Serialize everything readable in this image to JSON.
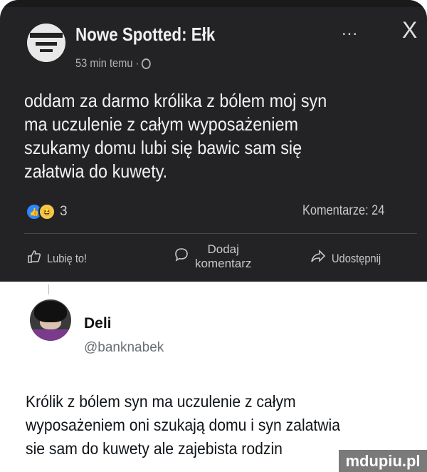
{
  "post": {
    "page_name": "Nowe Spotted: Ełk",
    "time": "53 min temu ·",
    "more": "...",
    "close": "X",
    "text": "oddam za darmo królika z bólem moj syn\nma uczulenie z całym wyposażeniem\nszukamy domu lubi się bawic sam się\nzałatwia do kuwety.",
    "reaction_count": "3",
    "comments": "Komentarze: 24",
    "actions": {
      "like": "Lubię to!",
      "comment_line1": "Dodaj",
      "comment_line2": "komentarz",
      "share": "Udostępnij"
    }
  },
  "tweet": {
    "name": "Deli",
    "handle": "@banknabek",
    "text": "Królik z bólem syn ma uczulenie z całym\nwyposażeniem oni szukają domu i syn zalatwia\nsie sam do kuwety ale zajebista rodzin"
  },
  "watermark": "mdupiu.pl",
  "colors": {
    "fb_background": "#232325",
    "tweet_background": "#ffffff",
    "like_blue": "#2d88ff",
    "haha_yellow": "#f7c74c"
  }
}
